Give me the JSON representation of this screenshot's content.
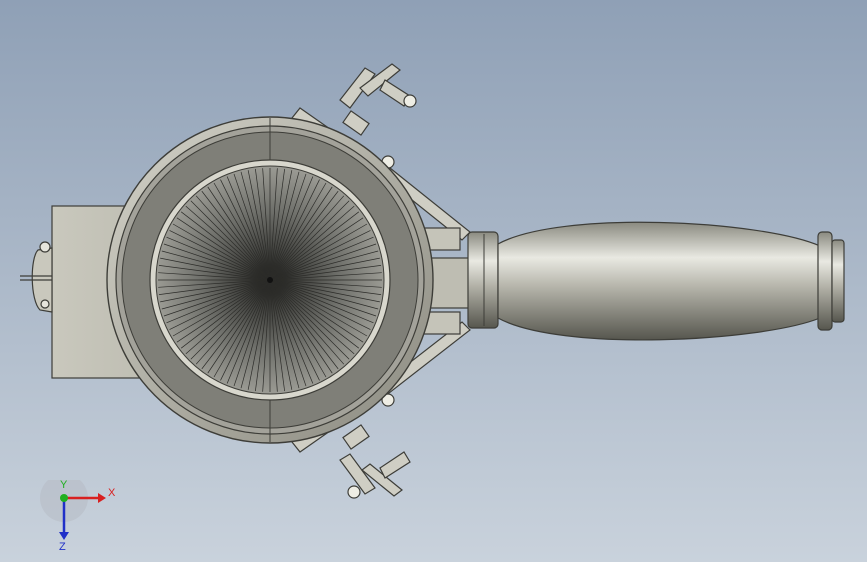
{
  "viewport": {
    "background_top": "#8fa0b6",
    "background_bottom": "#c9d2dc"
  },
  "model": {
    "name": "",
    "metal_color": "#b9b7ab",
    "shadow_color": "#55564f"
  },
  "triad": {
    "x_label": "X",
    "y_label": "Y",
    "z_label": "Z",
    "x_color": "#d82020",
    "y_color": "#20b020",
    "z_color": "#2030c8"
  }
}
